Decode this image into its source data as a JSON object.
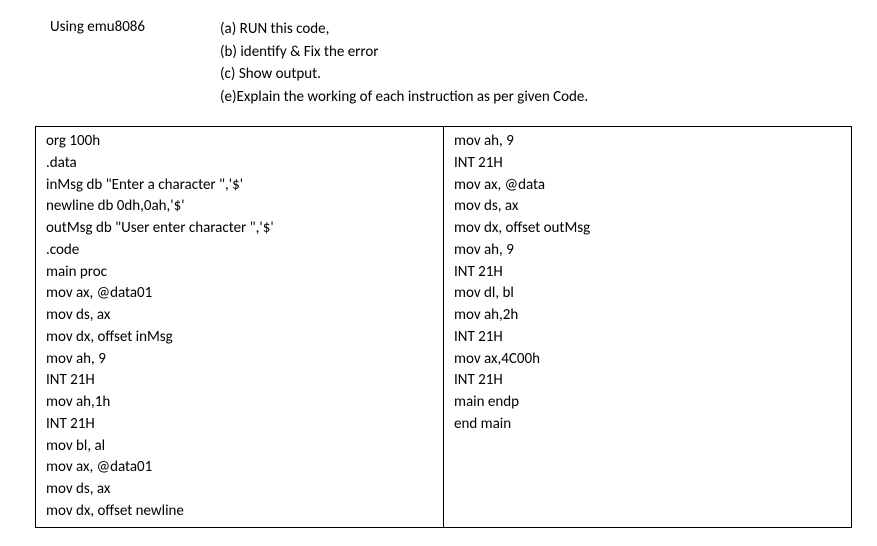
{
  "header": {
    "tool_label": "Using emu8086",
    "tasks": [
      "(a) RUN this code,",
      "(b) identify & Fix the error",
      "(c) Show output.",
      "(e)Explain the working of each instruction as per given Code."
    ]
  },
  "code": {
    "left": [
      "org 100h",
      ".data",
      "inMsg db \"Enter a character \",'$'",
      "newline db 0dh,0ah,'$'",
      "outMsg db \"User enter character \",'$'",
      ".code",
      "main proc",
      "mov ax, @data01",
      "mov ds, ax",
      "mov dx, offset inMsg",
      "mov ah, 9",
      "INT 21H",
      "mov ah,1h",
      "INT 21H",
      "mov bl, al",
      "mov ax, @data01",
      "mov ds, ax",
      "mov dx, offset newline"
    ],
    "right": [
      "mov ah, 9",
      "INT 21H",
      "mov ax, @data",
      "mov ds, ax",
      "mov dx, offset outMsg",
      "mov ah, 9",
      "INT 21H",
      "mov dl, bl",
      "mov ah,2h",
      "INT 21H",
      "mov ax,4C00h",
      "INT 21H",
      "main endp",
      "end main"
    ]
  }
}
